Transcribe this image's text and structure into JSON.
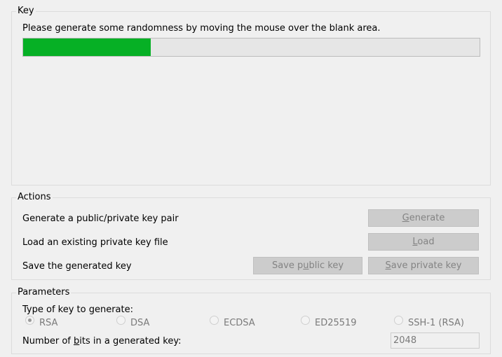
{
  "key_group": {
    "legend": "Key",
    "instruction": "Please generate some randomness by moving the mouse over the blank area.",
    "progress_fraction": 0.28,
    "progress_color": "#06b025"
  },
  "actions_group": {
    "legend": "Actions",
    "rows": [
      {
        "label": "Generate a public/private key pair"
      },
      {
        "label": "Load an existing private key file"
      },
      {
        "label": "Save the generated key"
      }
    ],
    "generate_button": {
      "pre": "",
      "accel": "G",
      "post": "enerate"
    },
    "load_button": {
      "pre": "",
      "accel": "L",
      "post": "oad"
    },
    "save_public_button": {
      "pre": "Save p",
      "accel": "u",
      "post": "blic key"
    },
    "save_private_button": {
      "pre": "",
      "accel": "S",
      "post": "ave private key"
    }
  },
  "parameters_group": {
    "legend": "Parameters",
    "key_type_label": "Type of key to generate:",
    "key_types": [
      {
        "label": "RSA",
        "checked": true
      },
      {
        "label": "DSA",
        "checked": false
      },
      {
        "label": "ECDSA",
        "checked": false
      },
      {
        "label": "ED25519",
        "checked": false
      },
      {
        "label": "SSH-1 (RSA)",
        "checked": false
      }
    ],
    "bits_label": {
      "pre": "Number of ",
      "accel": "b",
      "post": "its in a generated key:"
    },
    "bits_value": "2048"
  }
}
